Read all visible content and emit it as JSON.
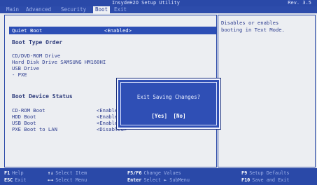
{
  "title": "InsydeH2O Setup Utility",
  "revision": "Rev. 3.5",
  "tabs": [
    {
      "label": "Main"
    },
    {
      "label": "Advanced"
    },
    {
      "label": "Security"
    },
    {
      "label": "Boot",
      "active": true
    },
    {
      "label": "Exit"
    }
  ],
  "boot": {
    "quiet_boot_label": "Quiet Boot",
    "quiet_boot_value": "<Enabled>",
    "boot_type_order": "Boot Type Order",
    "order_items": [
      "CD/DVD-ROM Drive",
      "Hard Disk Drive  SAMSUNG HM160HI",
      "USB Drive",
      "- PXE"
    ],
    "device_status_head": "Boot Device Status",
    "device_rows": [
      {
        "label": "CD-ROM Boot",
        "value": "<Enabled>"
      },
      {
        "label": "HDD Boot",
        "value": "<Enabled>"
      },
      {
        "label": "USB Boot",
        "value": "<Enabled>"
      },
      {
        "label": "PXE Boot to LAN",
        "value": "<Disabled>"
      }
    ]
  },
  "help": {
    "text": "Disables or enables\nbooting in Text Mode."
  },
  "dialog": {
    "title": "Exit Saving Changes?",
    "yes": "[Yes]",
    "no": "[No]"
  },
  "footer": {
    "keys": [
      {
        "key": "F1",
        "action": "Help"
      },
      {
        "key": "ESC",
        "action": "Exit"
      },
      {
        "key": "↑↓",
        "action": "Select Item"
      },
      {
        "key": "←→",
        "action": "Select Menu"
      },
      {
        "key": "F5/F6",
        "action": "Change Values"
      },
      {
        "key": "Enter",
        "action": "Select ► SubMenu"
      },
      {
        "key": "F9",
        "action": "Setup Defaults"
      },
      {
        "key": "F10",
        "action": "Save and Exit"
      }
    ]
  },
  "colors": {
    "bios_blue": "#2a49a8",
    "panel_bg": "#eceef2",
    "text_blue": "#2b3b8e"
  }
}
